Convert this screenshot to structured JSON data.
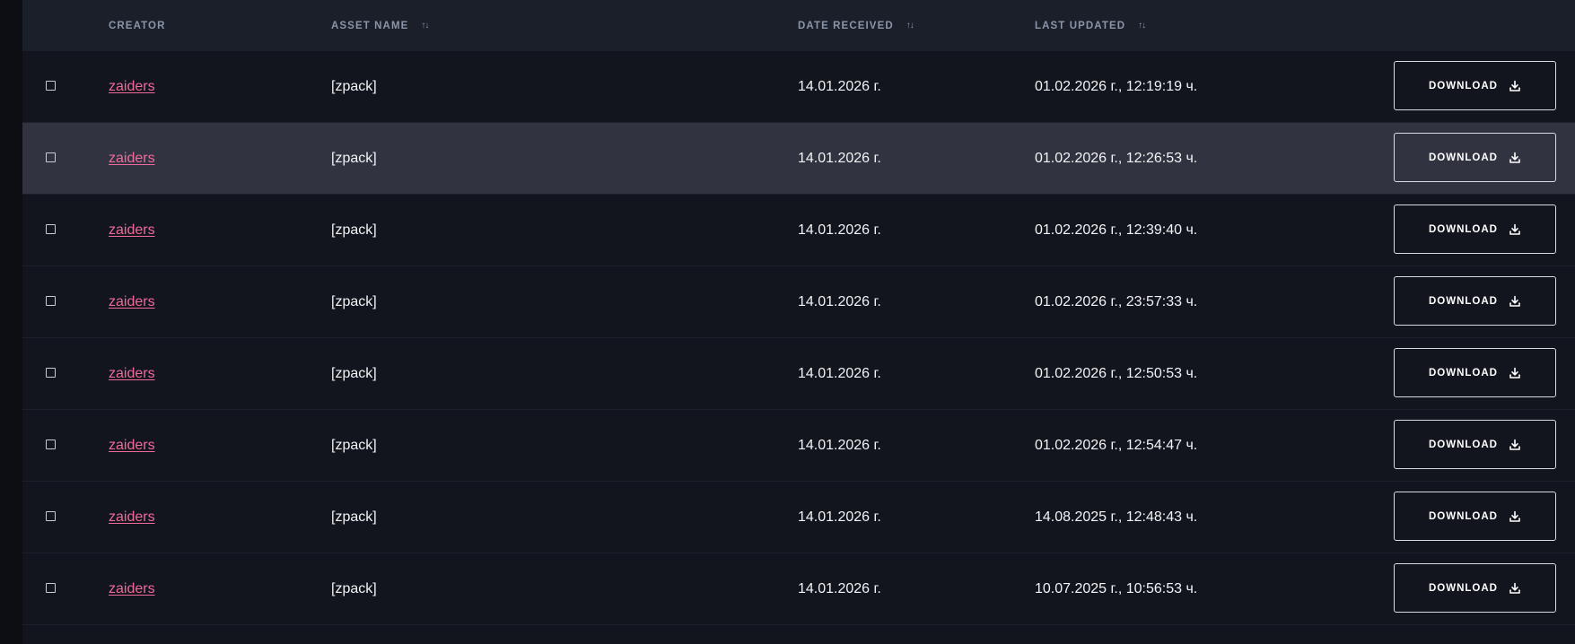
{
  "table": {
    "columns": {
      "creator": "CREATOR",
      "asset_name": "ASSET NAME",
      "date_received": "DATE RECEIVED",
      "last_updated": "LAST UPDATED"
    },
    "sort_icon": "sort-arrows-icon",
    "download_label": "DOWNLOAD",
    "download_icon": "download-icon",
    "colors": {
      "creator_link": "#f06a9c",
      "header_bg": "#1b1f2a",
      "row_bg": "#12151d",
      "row_hover_bg": "#313440"
    },
    "rows": [
      {
        "creator": "zaiders",
        "asset_name": "[zpack]",
        "date_received": "14.01.2026 г.",
        "last_updated": "01.02.2026 г., 12:19:19 ч.",
        "hovered": false
      },
      {
        "creator": "zaiders",
        "asset_name": "[zpack]",
        "date_received": "14.01.2026 г.",
        "last_updated": "01.02.2026 г., 12:26:53 ч.",
        "hovered": true
      },
      {
        "creator": "zaiders",
        "asset_name": "[zpack]",
        "date_received": "14.01.2026 г.",
        "last_updated": "01.02.2026 г., 12:39:40 ч.",
        "hovered": false
      },
      {
        "creator": "zaiders",
        "asset_name": "[zpack]",
        "date_received": "14.01.2026 г.",
        "last_updated": "01.02.2026 г., 23:57:33 ч.",
        "hovered": false
      },
      {
        "creator": "zaiders",
        "asset_name": "[zpack]",
        "date_received": "14.01.2026 г.",
        "last_updated": "01.02.2026 г., 12:50:53 ч.",
        "hovered": false
      },
      {
        "creator": "zaiders",
        "asset_name": "[zpack]",
        "date_received": "14.01.2026 г.",
        "last_updated": "01.02.2026 г., 12:54:47 ч.",
        "hovered": false
      },
      {
        "creator": "zaiders",
        "asset_name": "[zpack]",
        "date_received": "14.01.2026 г.",
        "last_updated": "14.08.2025 г., 12:48:43 ч.",
        "hovered": false
      },
      {
        "creator": "zaiders",
        "asset_name": "[zpack]",
        "date_received": "14.01.2026 г.",
        "last_updated": "10.07.2025 г., 10:56:53 ч.",
        "hovered": false
      }
    ]
  }
}
